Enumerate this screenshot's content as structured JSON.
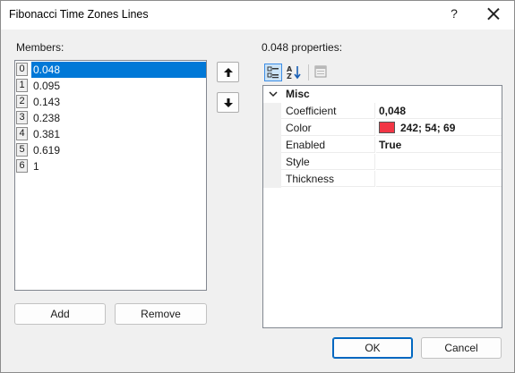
{
  "window": {
    "title": "Fibonacci Time Zones Lines",
    "help_label": "?",
    "close_icon": "close-icon"
  },
  "members": {
    "label": "Members:",
    "items": [
      {
        "index": "0",
        "value": "0.048",
        "selected": true
      },
      {
        "index": "1",
        "value": "0.095"
      },
      {
        "index": "2",
        "value": "0.143"
      },
      {
        "index": "3",
        "value": "0.238"
      },
      {
        "index": "4",
        "value": "0.381"
      },
      {
        "index": "5",
        "value": "0.619"
      },
      {
        "index": "6",
        "value": "1"
      }
    ],
    "move_up_icon": "arrow-up-icon",
    "move_down_icon": "arrow-down-icon",
    "add_label": "Add",
    "remove_label": "Remove"
  },
  "properties": {
    "label": "0.048 properties:",
    "toolbar": {
      "categorized_icon": "categorized-view-icon",
      "alphabetical_icon": "alphabetical-sort-icon",
      "property_pages_icon": "property-pages-icon"
    },
    "category": "Misc",
    "rows": [
      {
        "name": "Coefficient",
        "value": "0,048"
      },
      {
        "name": "Color",
        "value": "242; 54; 69",
        "swatch": "#f23645"
      },
      {
        "name": "Enabled",
        "value": "True"
      },
      {
        "name": "Style",
        "value": ""
      },
      {
        "name": "Thickness",
        "value": ""
      }
    ]
  },
  "footer": {
    "ok_label": "OK",
    "cancel_label": "Cancel"
  },
  "colors": {
    "selection": "#0078d7",
    "accent": "#0067c0",
    "dialog_bg": "#f0f0f0"
  }
}
